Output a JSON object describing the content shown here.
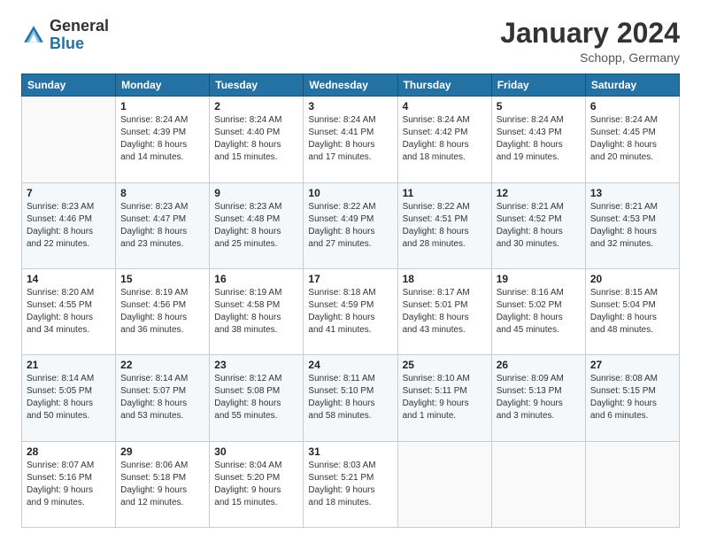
{
  "header": {
    "logo_line1": "General",
    "logo_line2": "Blue",
    "month": "January 2024",
    "location": "Schopp, Germany"
  },
  "days_of_week": [
    "Sunday",
    "Monday",
    "Tuesday",
    "Wednesday",
    "Thursday",
    "Friday",
    "Saturday"
  ],
  "weeks": [
    [
      {
        "day": "",
        "info": ""
      },
      {
        "day": "1",
        "info": "Sunrise: 8:24 AM\nSunset: 4:39 PM\nDaylight: 8 hours\nand 14 minutes."
      },
      {
        "day": "2",
        "info": "Sunrise: 8:24 AM\nSunset: 4:40 PM\nDaylight: 8 hours\nand 15 minutes."
      },
      {
        "day": "3",
        "info": "Sunrise: 8:24 AM\nSunset: 4:41 PM\nDaylight: 8 hours\nand 17 minutes."
      },
      {
        "day": "4",
        "info": "Sunrise: 8:24 AM\nSunset: 4:42 PM\nDaylight: 8 hours\nand 18 minutes."
      },
      {
        "day": "5",
        "info": "Sunrise: 8:24 AM\nSunset: 4:43 PM\nDaylight: 8 hours\nand 19 minutes."
      },
      {
        "day": "6",
        "info": "Sunrise: 8:24 AM\nSunset: 4:45 PM\nDaylight: 8 hours\nand 20 minutes."
      }
    ],
    [
      {
        "day": "7",
        "info": "Sunrise: 8:23 AM\nSunset: 4:46 PM\nDaylight: 8 hours\nand 22 minutes."
      },
      {
        "day": "8",
        "info": "Sunrise: 8:23 AM\nSunset: 4:47 PM\nDaylight: 8 hours\nand 23 minutes."
      },
      {
        "day": "9",
        "info": "Sunrise: 8:23 AM\nSunset: 4:48 PM\nDaylight: 8 hours\nand 25 minutes."
      },
      {
        "day": "10",
        "info": "Sunrise: 8:22 AM\nSunset: 4:49 PM\nDaylight: 8 hours\nand 27 minutes."
      },
      {
        "day": "11",
        "info": "Sunrise: 8:22 AM\nSunset: 4:51 PM\nDaylight: 8 hours\nand 28 minutes."
      },
      {
        "day": "12",
        "info": "Sunrise: 8:21 AM\nSunset: 4:52 PM\nDaylight: 8 hours\nand 30 minutes."
      },
      {
        "day": "13",
        "info": "Sunrise: 8:21 AM\nSunset: 4:53 PM\nDaylight: 8 hours\nand 32 minutes."
      }
    ],
    [
      {
        "day": "14",
        "info": "Sunrise: 8:20 AM\nSunset: 4:55 PM\nDaylight: 8 hours\nand 34 minutes."
      },
      {
        "day": "15",
        "info": "Sunrise: 8:19 AM\nSunset: 4:56 PM\nDaylight: 8 hours\nand 36 minutes."
      },
      {
        "day": "16",
        "info": "Sunrise: 8:19 AM\nSunset: 4:58 PM\nDaylight: 8 hours\nand 38 minutes."
      },
      {
        "day": "17",
        "info": "Sunrise: 8:18 AM\nSunset: 4:59 PM\nDaylight: 8 hours\nand 41 minutes."
      },
      {
        "day": "18",
        "info": "Sunrise: 8:17 AM\nSunset: 5:01 PM\nDaylight: 8 hours\nand 43 minutes."
      },
      {
        "day": "19",
        "info": "Sunrise: 8:16 AM\nSunset: 5:02 PM\nDaylight: 8 hours\nand 45 minutes."
      },
      {
        "day": "20",
        "info": "Sunrise: 8:15 AM\nSunset: 5:04 PM\nDaylight: 8 hours\nand 48 minutes."
      }
    ],
    [
      {
        "day": "21",
        "info": "Sunrise: 8:14 AM\nSunset: 5:05 PM\nDaylight: 8 hours\nand 50 minutes."
      },
      {
        "day": "22",
        "info": "Sunrise: 8:14 AM\nSunset: 5:07 PM\nDaylight: 8 hours\nand 53 minutes."
      },
      {
        "day": "23",
        "info": "Sunrise: 8:12 AM\nSunset: 5:08 PM\nDaylight: 8 hours\nand 55 minutes."
      },
      {
        "day": "24",
        "info": "Sunrise: 8:11 AM\nSunset: 5:10 PM\nDaylight: 8 hours\nand 58 minutes."
      },
      {
        "day": "25",
        "info": "Sunrise: 8:10 AM\nSunset: 5:11 PM\nDaylight: 9 hours\nand 1 minute."
      },
      {
        "day": "26",
        "info": "Sunrise: 8:09 AM\nSunset: 5:13 PM\nDaylight: 9 hours\nand 3 minutes."
      },
      {
        "day": "27",
        "info": "Sunrise: 8:08 AM\nSunset: 5:15 PM\nDaylight: 9 hours\nand 6 minutes."
      }
    ],
    [
      {
        "day": "28",
        "info": "Sunrise: 8:07 AM\nSunset: 5:16 PM\nDaylight: 9 hours\nand 9 minutes."
      },
      {
        "day": "29",
        "info": "Sunrise: 8:06 AM\nSunset: 5:18 PM\nDaylight: 9 hours\nand 12 minutes."
      },
      {
        "day": "30",
        "info": "Sunrise: 8:04 AM\nSunset: 5:20 PM\nDaylight: 9 hours\nand 15 minutes."
      },
      {
        "day": "31",
        "info": "Sunrise: 8:03 AM\nSunset: 5:21 PM\nDaylight: 9 hours\nand 18 minutes."
      },
      {
        "day": "",
        "info": ""
      },
      {
        "day": "",
        "info": ""
      },
      {
        "day": "",
        "info": ""
      }
    ]
  ]
}
